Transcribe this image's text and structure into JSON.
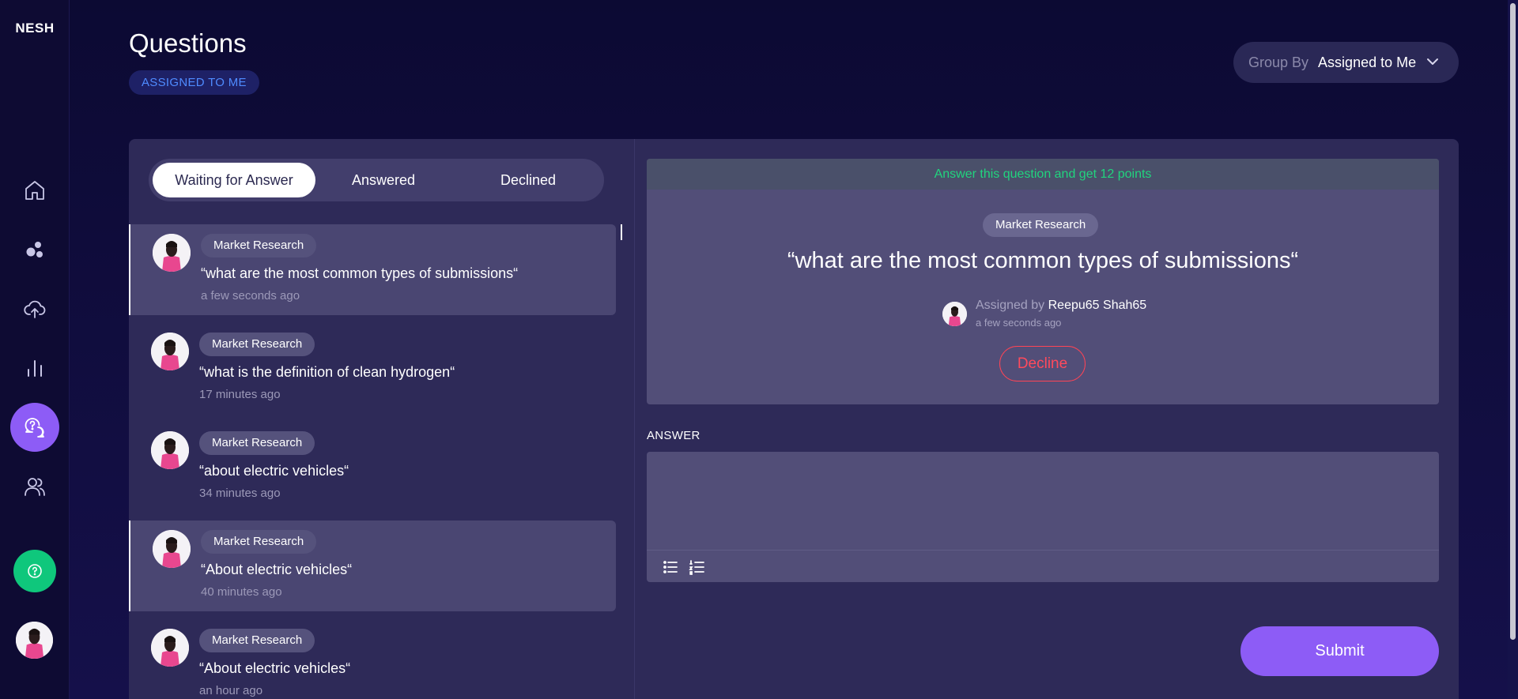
{
  "app": {
    "logo": "NESH"
  },
  "sidebar": {
    "items": [
      {
        "name": "home",
        "icon": "home-icon"
      },
      {
        "name": "bubbles",
        "icon": "bubbles-icon"
      },
      {
        "name": "upload",
        "icon": "cloud-upload-icon"
      },
      {
        "name": "analytics",
        "icon": "bar-chart-icon"
      },
      {
        "name": "questions",
        "icon": "question-chat-icon",
        "active": true
      },
      {
        "name": "users",
        "icon": "users-icon"
      }
    ],
    "help_icon": "question-circle-icon",
    "accent": "#8d5cf6",
    "help_color": "#0fc77c"
  },
  "header": {
    "title": "Questions",
    "filter_chip": "ASSIGNED TO ME",
    "group_by": {
      "label": "Group By",
      "value": "Assigned to Me"
    }
  },
  "tabs": [
    {
      "label": "Waiting for Answer",
      "active": true
    },
    {
      "label": "Answered",
      "active": false
    },
    {
      "label": "Declined",
      "active": false
    }
  ],
  "questions": [
    {
      "tag": "Market Research",
      "text": "“what are the most common types of submissions“",
      "time": "a few seconds ago",
      "highlight": true
    },
    {
      "tag": "Market Research",
      "text": "“what is the definition of clean hydrogen“",
      "time": "17 minutes ago",
      "highlight": false
    },
    {
      "tag": "Market Research",
      "text": "“about electric vehicles“",
      "time": "34 minutes ago",
      "highlight": false
    },
    {
      "tag": "Market Research",
      "text": "“About electric vehicles“",
      "time": "40 minutes ago",
      "highlight": true
    },
    {
      "tag": "Market Research",
      "text": "“About electric vehicles“",
      "time": "an hour ago",
      "highlight": false
    }
  ],
  "detail": {
    "points_banner": "Answer this question and get 12 points",
    "tag": "Market Research",
    "question": "“what are the most common types of submissions“",
    "assigned_by_label": "Assigned by",
    "assigned_by_name": "Reepu65 Shah65",
    "time": "a few seconds ago",
    "decline_label": "Decline",
    "answer_label": "ANSWER",
    "answer_value": "",
    "toolbar": [
      "bullet-list-icon",
      "numbered-list-icon"
    ],
    "submit_label": "Submit"
  },
  "colors": {
    "background": "#0f0c38",
    "panel": "#2e2a58",
    "points_text": "#21d47e",
    "decline": "#ff4a5c",
    "chip_text": "#4f8bff"
  }
}
